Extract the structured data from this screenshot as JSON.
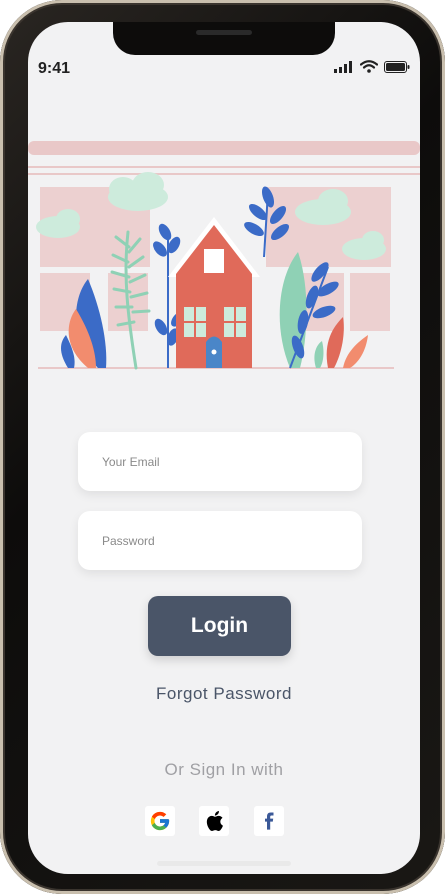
{
  "status_bar": {
    "time": "9:41"
  },
  "form": {
    "email_placeholder": "Your Email",
    "password_placeholder": "Password"
  },
  "login_label": "Login",
  "forgot_label": "Forgot Password",
  "social": {
    "label": "Or Sign In with",
    "providers": [
      "google",
      "apple",
      "facebook"
    ]
  },
  "colors": {
    "primary": "#4a5568",
    "background": "#f2f2f3",
    "house": "#e06a5a",
    "accent_blue": "#3b6bc7",
    "accent_green": "#8fd1b5",
    "pink": "#e9c8c8"
  }
}
